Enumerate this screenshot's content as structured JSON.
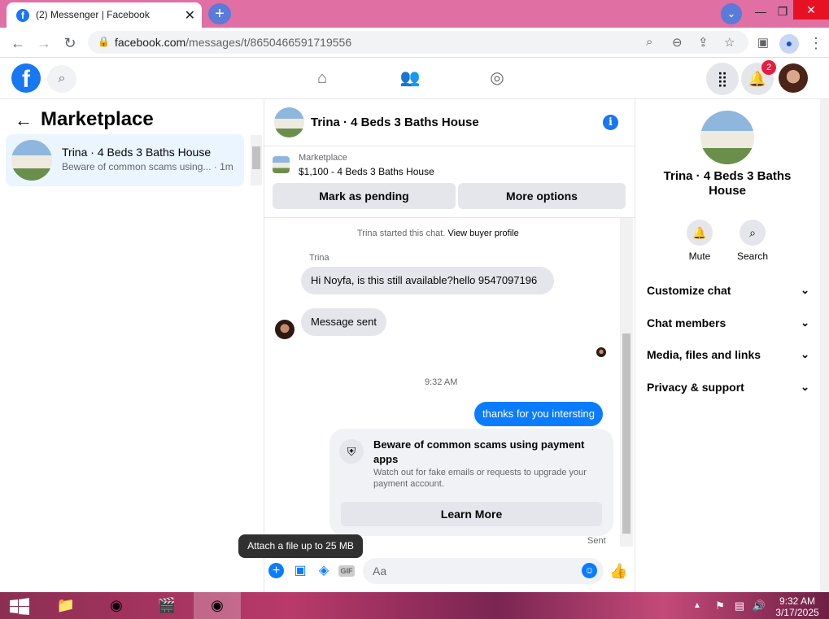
{
  "browser": {
    "tab_title": "(2) Messenger | Facebook",
    "url_host": "facebook.com",
    "url_path": "/messages/t/8650466591719556"
  },
  "fb_header": {
    "notification_count": "2"
  },
  "left_panel": {
    "title": "Marketplace",
    "chat": {
      "name": "Trina · 4 Beds 3 Baths House",
      "preview": "Beware of common scams using... · 1m"
    }
  },
  "center": {
    "chat_title": "Trina · 4 Beds 3 Baths House",
    "listing_label": "Marketplace",
    "listing_price_title": "$1,100 - 4 Beds 3 Baths House",
    "mark_pending_label": "Mark as pending",
    "more_options_label": "More options",
    "started_text": "Trina started this chat.",
    "view_profile_link": "View buyer profile",
    "sender_name": "Trina",
    "msg1": "Hi Noyfa, is this still available?hello 9547097196",
    "msg2": "Message sent",
    "timestamp": "9:32 AM",
    "outgoing_msg": "thanks for you intersting",
    "scam_title": "Beware of common scams using payment apps",
    "scam_desc": "Watch out for fake emails or requests to upgrade your payment account.",
    "learn_more_label": "Learn More",
    "sent_status": "Sent",
    "input_placeholder": "Aa",
    "tooltip": "Attach a file up to 25 MB"
  },
  "right_panel": {
    "name": "Trina · 4 Beds 3 Baths House",
    "mute_label": "Mute",
    "search_label": "Search",
    "menu": [
      "Customize chat",
      "Chat members",
      "Media, files and links",
      "Privacy & support"
    ]
  },
  "taskbar": {
    "time": "9:32 AM",
    "date": "3/17/2025"
  },
  "colors": {
    "accent": "#0a7cff",
    "fb_blue": "#1877f2",
    "tabstrip": "#e06fa3"
  }
}
